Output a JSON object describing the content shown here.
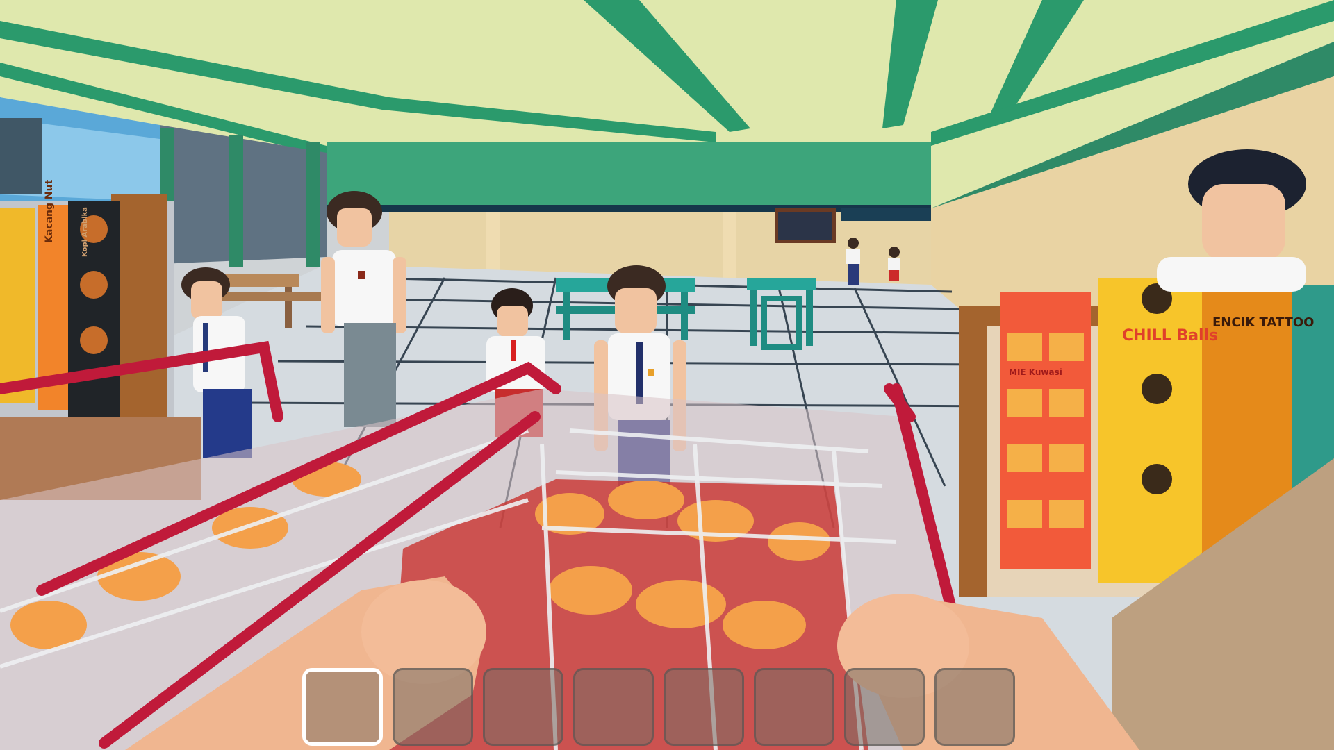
{
  "scene": {
    "title": "School canteen shop - first person view with shopping cart",
    "ceiling_color": "#dde7a8",
    "beam_color": "#2b9a6c",
    "wall_color": "#e8d2a2",
    "floor_color": "#d4dadd",
    "cart_color": "#c01a3a",
    "skin_color": "#f0b690"
  },
  "products": {
    "left_shelf": [
      "Kacang Nut",
      "Kopi Arabika",
      "Kopi Arabika",
      "Kopi Arabika"
    ],
    "right_shelf": [
      "CHILL Balls",
      "ENCIK TATTOO",
      "MIE Kuwasi"
    ]
  },
  "npcs": [
    {
      "name": "student-left-by-shelf"
    },
    {
      "name": "student-grey-pants"
    },
    {
      "name": "student-small-red-shorts"
    },
    {
      "name": "student-center-tie"
    },
    {
      "name": "student-far-1"
    },
    {
      "name": "student-far-2"
    },
    {
      "name": "shopkeeper-right"
    }
  ],
  "hotbar": {
    "selected_index": 0,
    "slots": [
      "",
      "",
      "",
      "",
      "",
      "",
      "",
      ""
    ]
  }
}
